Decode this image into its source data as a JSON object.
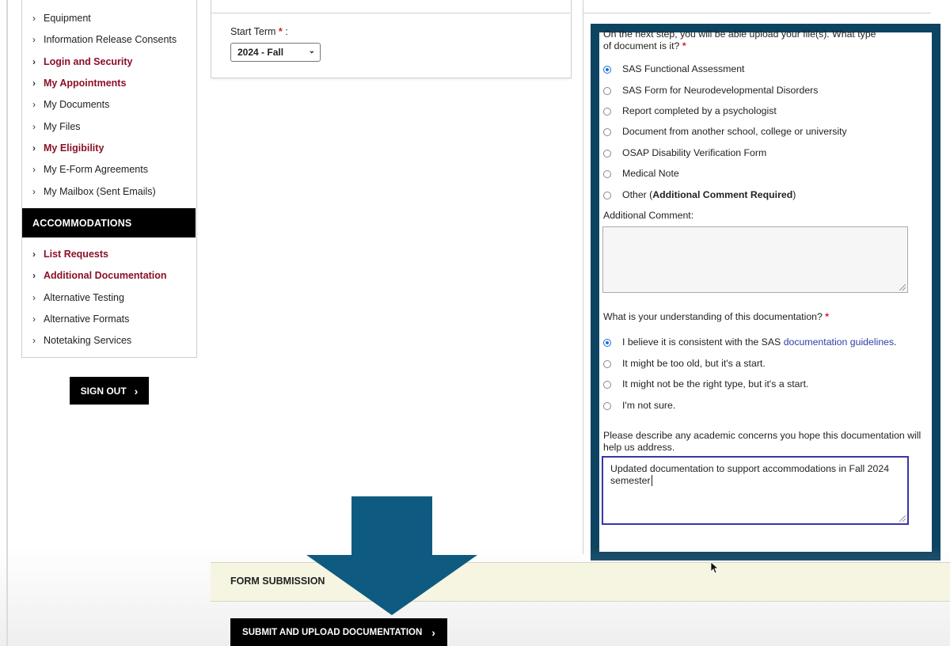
{
  "sidebar": {
    "items": [
      {
        "label": "Equipment",
        "highlight": false
      },
      {
        "label": "Information Release Consents",
        "highlight": false
      },
      {
        "label": "Login and Security",
        "highlight": true
      },
      {
        "label": "My Appointments",
        "highlight": true
      },
      {
        "label": "My Documents",
        "highlight": false
      },
      {
        "label": "My Files",
        "highlight": false
      },
      {
        "label": "My Eligibility",
        "highlight": true
      },
      {
        "label": "My E-Form Agreements",
        "highlight": false
      },
      {
        "label": "My Mailbox (Sent Emails)",
        "highlight": false
      }
    ],
    "accommodations_header": "ACCOMMODATIONS",
    "accommodation_items": [
      {
        "label": "List Requests",
        "highlight": true
      },
      {
        "label": "Additional Documentation",
        "highlight": true
      },
      {
        "label": "Alternative Testing",
        "highlight": false
      },
      {
        "label": "Alternative Formats",
        "highlight": false
      },
      {
        "label": "Notetaking Services",
        "highlight": false
      }
    ],
    "sign_out": "SIGN OUT"
  },
  "term": {
    "label": "Start Term",
    "required_mark": "*",
    "colon": ":",
    "selected": "2024 - Fall"
  },
  "document_form": {
    "question1_line1": "On the next step, you will be able upload your file(s). What type",
    "question1_line2": "of document is it?",
    "required_mark": "*",
    "doc_types": [
      {
        "label": "SAS Functional Assessment",
        "selected": true
      },
      {
        "label": "SAS Form for Neurodevelopmental Disorders",
        "selected": false
      },
      {
        "label": "Report completed by a psychologist",
        "selected": false
      },
      {
        "label": "Document from another school, college or university",
        "selected": false
      },
      {
        "label": "OSAP Disability Verification Form",
        "selected": false
      },
      {
        "label": "Medical Note",
        "selected": false
      }
    ],
    "other_option": {
      "prefix": "Other (",
      "bold": "Additional Comment Required",
      "suffix": ")",
      "selected": false
    },
    "additional_comment_label": "Additional Comment:",
    "additional_comment_value": "",
    "question2": "What is your understanding of this documentation?",
    "understanding_first": {
      "prefix": "I believe it is consistent with the SAS ",
      "link": "documentation guidelines",
      "suffix": ".",
      "selected": true
    },
    "understanding_options": [
      {
        "label": "It might be too old, but it's a start.",
        "selected": false
      },
      {
        "label": "It might not be the right type, but it's a start.",
        "selected": false
      },
      {
        "label": "I'm not sure.",
        "selected": false
      }
    ],
    "question3_line1": "Please describe any academic concerns you hope this documentation will",
    "question3_line2": "help us address.",
    "concerns_line1": "Updated documentation to support accommodations in Fall 2024",
    "concerns_line2": "semester"
  },
  "submission": {
    "title": "FORM SUBMISSION",
    "submit_label": "SUBMIT AND UPLOAD DOCUMENTATION"
  },
  "colors": {
    "highlight_frame": "#0d4461",
    "arrow": "#0f5a80",
    "brand_red": "#8a1027",
    "radio_selected": "#1f6fd8"
  },
  "icons": [
    "chevron-right-icon",
    "dropdown-caret-icon",
    "mouse-cursor-icon",
    "down-arrow-annotation"
  ]
}
